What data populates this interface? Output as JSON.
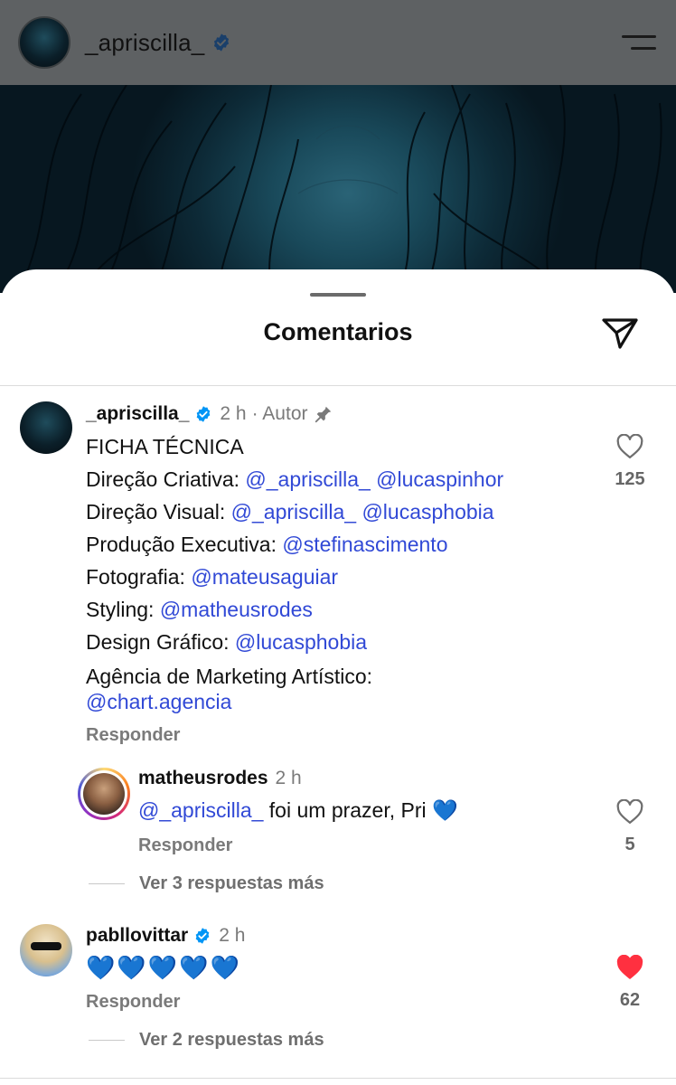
{
  "header": {
    "username": "_apriscilla_",
    "verified": true,
    "menu_icon": "menu-icon"
  },
  "sheet": {
    "title": "Comentarios",
    "share_icon": "paper-plane-icon"
  },
  "comments": [
    {
      "username": "_apriscilla_",
      "verified": true,
      "time": "2 h",
      "author_label": "· Autor",
      "pinned": true,
      "lines": [
        {
          "plain": "FICHA TÉCNICA",
          "mentions": ""
        },
        {
          "plain": "Direção Criativa:",
          "mentions": "@_apriscilla_ @lucaspinhor"
        },
        {
          "plain": "Direção Visual:",
          "mentions": "@_apriscilla_ @lucasphobia"
        },
        {
          "plain": "Produção Executiva:",
          "mentions": "@stefinascimento"
        },
        {
          "plain": "Fotografia:",
          "mentions": "@mateusaguiar"
        },
        {
          "plain": "Styling:",
          "mentions": "@matheusrodes"
        },
        {
          "plain": "Design Gráfico:",
          "mentions": "@lucasphobia"
        },
        {
          "plain": "Agência de Marketing Artístico:",
          "mentions": ""
        },
        {
          "plain": "",
          "mentions": "@chart.agencia"
        }
      ],
      "reply_label": "Responder",
      "likes": "125",
      "liked": false
    },
    {
      "username": "matheusrodes",
      "verified": false,
      "time": "2 h",
      "mention": "@_apriscilla_",
      "text": "foi um prazer, Pri",
      "emoji": "💙",
      "reply_label": "Responder",
      "likes": "5",
      "liked": false,
      "more_replies": "Ver 3 respuestas más"
    },
    {
      "username": "pabllovittar",
      "verified": true,
      "time": "2 h",
      "text": "💙💙💙💙💙",
      "reply_label": "Responder",
      "likes": "62",
      "liked": true,
      "more_replies": "Ver 2 respuestas más"
    }
  ],
  "colors": {
    "mention": "#3149d6",
    "verified": "#0095f6",
    "liked_heart": "#ff3040",
    "header_bg": "#5e6163"
  }
}
